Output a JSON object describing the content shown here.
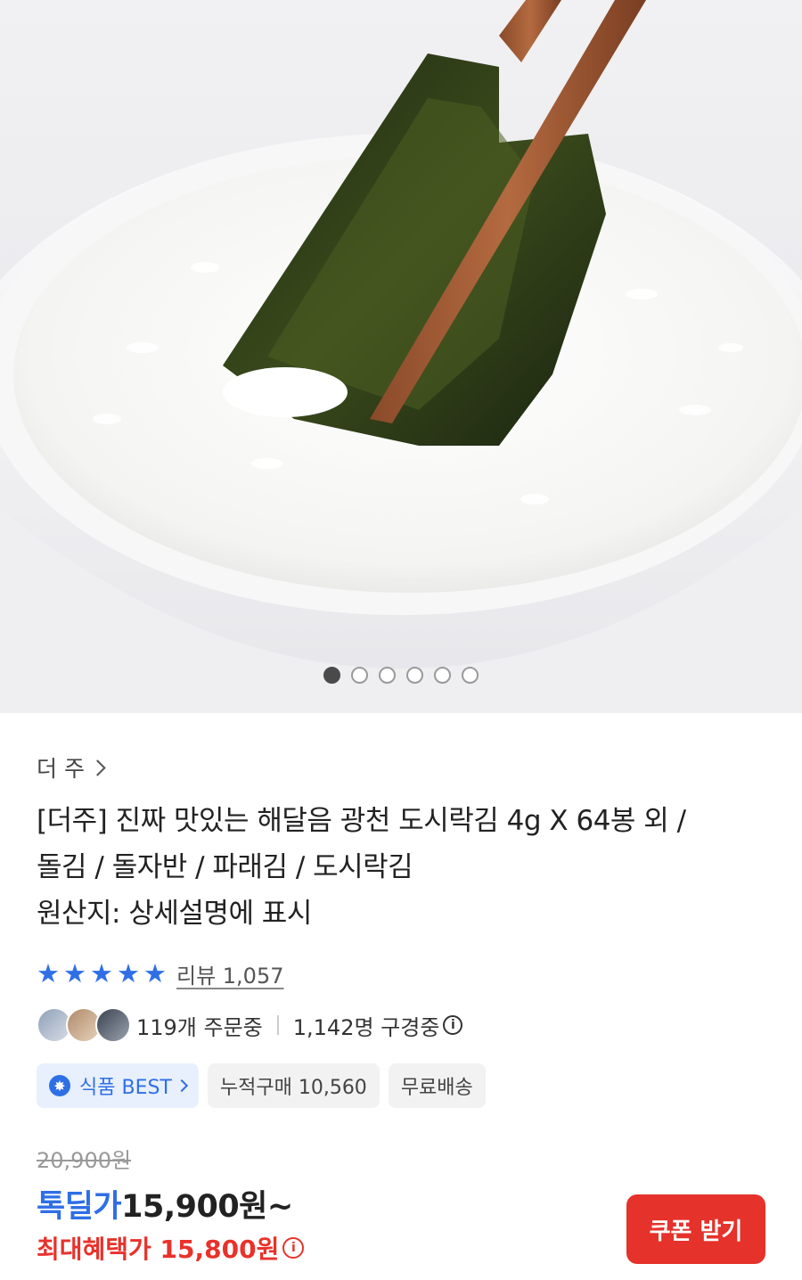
{
  "gallery": {
    "total": 6,
    "active": 0
  },
  "product": {
    "brand": "더 주",
    "title_lines": [
      "[더주] 진짜 맛있는 해달음 광천 도시락김 4g X 64봉 외 /",
      "돌김 / 돌자반 / 파래김 / 도시락김",
      "원산지: 상세설명에 표시"
    ],
    "rating_stars": 5,
    "review_label": "리뷰 1,057",
    "ordering": "119개 주문중",
    "viewing": "1,142명 구경중",
    "badges": {
      "best": "식품 BEST",
      "cumulative": "누적구매 10,560",
      "shipping": "무료배송"
    },
    "original_price": "20,900원",
    "deal_label": "톡딜가",
    "deal_price": "15,900원~",
    "max_benefit": "최대혜택가 15,800원",
    "coupon_button": "쿠폰 받기"
  },
  "colors": {
    "accent_blue": "#2f6fe6",
    "accent_red": "#e5322b"
  },
  "icons": [
    "star-icon",
    "info-icon",
    "gear-icon",
    "chevron-right-icon"
  ]
}
